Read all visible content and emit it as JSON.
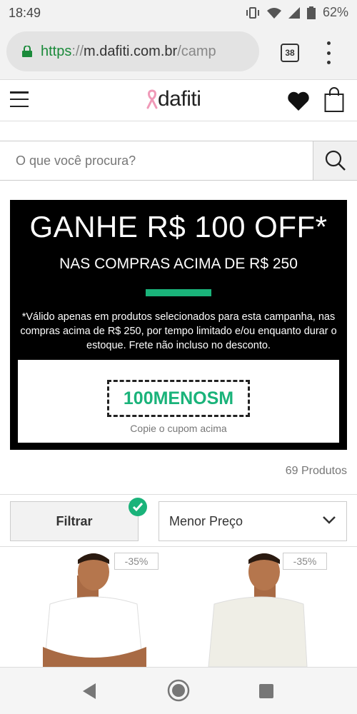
{
  "status": {
    "time": "18:49",
    "battery": "62%"
  },
  "browser": {
    "url_scheme": "https",
    "url_sep": "://",
    "url_host": "m.dafiti.com.br",
    "url_path": "/camp",
    "tab_count": "38"
  },
  "header": {
    "logo_text": "dafiti"
  },
  "search": {
    "placeholder": "O que você procura?"
  },
  "promo": {
    "headline": "GANHE R$ 100 OFF*",
    "subheadline": "NAS COMPRAS ACIMA DE R$ 250",
    "terms": "*Válido apenas em produtos selecionados para esta campanha, nas compras acima de R$ 250, por tempo limitado e/ou enquanto durar o estoque. Frete não incluso no desconto.",
    "coupon_code": "100MENOSM",
    "coupon_hint": "Copie o cupom acima",
    "accent_color": "#1ab37a"
  },
  "listing": {
    "product_count": "69 Produtos",
    "filter_label": "Filtrar",
    "sort_selected": "Menor Preço",
    "products": [
      {
        "discount": "-35%"
      },
      {
        "discount": "-35%"
      }
    ]
  },
  "icons": [
    "lock-icon",
    "menu-icon",
    "heart-icon",
    "bag-icon",
    "search-icon",
    "check-icon",
    "chevron-down-icon",
    "back-icon",
    "home-icon",
    "recents-icon"
  ]
}
